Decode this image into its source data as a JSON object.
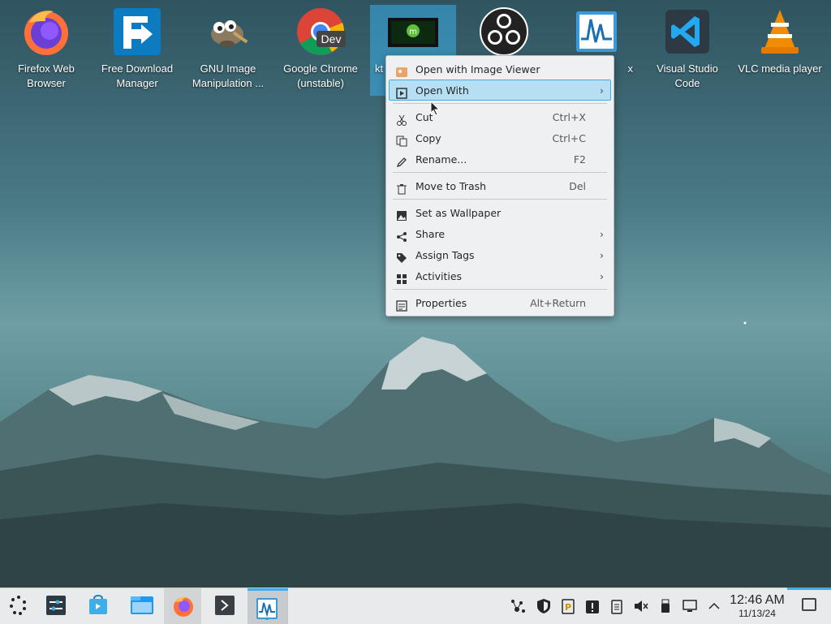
{
  "desktop": {
    "icons": [
      {
        "label": "Firefox Web Browser",
        "icon": "firefox-icon"
      },
      {
        "label": "Free Download Manager",
        "icon": "fdm-icon"
      },
      {
        "label": "GNU Image Manipulation ...",
        "icon": "gimp-icon"
      },
      {
        "label": "Google Chrome (unstable)",
        "icon": "chrome-dev-icon",
        "badge": "Dev"
      },
      {
        "label": "kt",
        "icon": "image-file-icon"
      },
      {
        "label": "",
        "icon": "obs-icon"
      },
      {
        "label": "x",
        "icon": "ksysguard-icon"
      },
      {
        "label": "Visual Studio Code",
        "icon": "vscode-icon"
      },
      {
        "label": "VLC media player",
        "icon": "vlc-icon"
      }
    ]
  },
  "context_menu": {
    "items": [
      {
        "label": "Open with Image Viewer",
        "shortcut": "",
        "icon": "image-viewer-icon"
      },
      {
        "label": "Open With",
        "shortcut": "",
        "icon": "open-with-icon",
        "submenu": true
      },
      {
        "label": "Cut",
        "shortcut": "Ctrl+X",
        "icon": "scissors-icon"
      },
      {
        "label": "Copy",
        "shortcut": "Ctrl+C",
        "icon": "copy-icon"
      },
      {
        "label": "Rename...",
        "shortcut": "F2",
        "icon": "pencil-icon"
      },
      {
        "label": "Move to Trash",
        "shortcut": "Del",
        "icon": "trash-icon"
      },
      {
        "label": "Set as Wallpaper",
        "shortcut": "",
        "icon": "wallpaper-icon"
      },
      {
        "label": "Share",
        "shortcut": "",
        "icon": "share-icon",
        "submenu": true
      },
      {
        "label": "Assign Tags",
        "shortcut": "",
        "icon": "tag-icon",
        "submenu": true
      },
      {
        "label": "Activities",
        "shortcut": "",
        "icon": "activities-icon",
        "submenu": true
      },
      {
        "label": "Properties",
        "shortcut": "Alt+Return",
        "icon": "properties-icon"
      }
    ]
  },
  "taskbar": {
    "launchers": [
      "app-launcher-icon",
      "system-settings-icon",
      "discover-icon",
      "dolphin-icon",
      "firefox-icon",
      "konsole-icon",
      "ksysguard-icon"
    ],
    "tray": [
      "network-icon",
      "shield-icon",
      "clipboard-p-icon",
      "notifications-icon",
      "clipboard-icon",
      "volume-muted-icon",
      "usb-icon",
      "display-icon",
      "tray-expand-icon"
    ],
    "clock": {
      "time": "12:46 AM",
      "date": "11/13/24"
    }
  },
  "colors": {
    "accent": "#3daee9",
    "menu_bg": "#eff0f1",
    "highlight": "#b6dff3",
    "taskbar_bg": "#e9eaeb"
  }
}
